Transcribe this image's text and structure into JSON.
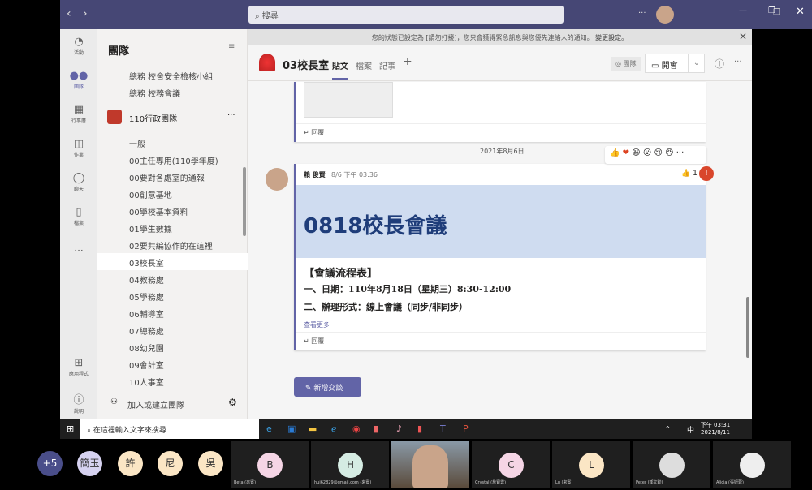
{
  "topbar": {
    "back": "‹",
    "forward": "›",
    "search_placeholder": "搜尋",
    "more": "···"
  },
  "rail": [
    {
      "label": "活動",
      "icon": "bell-icon",
      "glyph": "🔔"
    },
    {
      "label": "團隊",
      "icon": "teams-icon",
      "glyph": "👥"
    },
    {
      "label": "行事曆",
      "icon": "calendar-icon",
      "glyph": "📅"
    },
    {
      "label": "作業",
      "icon": "assignments-icon",
      "glyph": "🎒"
    },
    {
      "label": "聊天",
      "icon": "chat-icon",
      "glyph": "💬"
    },
    {
      "label": "檔案",
      "icon": "file-icon",
      "glyph": "📄"
    },
    {
      "label": "···",
      "icon": "more-icon",
      "glyph": ""
    },
    {
      "label": "應用程式",
      "icon": "apps-icon",
      "glyph": "⊞"
    },
    {
      "label": "說明",
      "icon": "help-icon",
      "glyph": "?"
    }
  ],
  "sidebar": {
    "title": "團隊",
    "channels_top": [
      "總務 校舍安全檢核小組",
      "總務 校務會議"
    ],
    "team_name": "110行政團隊",
    "channels": [
      "一般",
      "00主任專用(110學年度)",
      "00要對各處室的通報",
      "00創意基地",
      "00學校基本資料",
      "01學生數據",
      "02要共編協作的在這裡",
      "03校長室",
      "04教務處",
      "05學務處",
      "06輔導室",
      "07總務處",
      "08幼兒園",
      "09會計室",
      "10人事室"
    ],
    "selected": "03校長室",
    "add_team": "加入或建立團隊"
  },
  "banner": {
    "text": "您的狀態已設定為 [請勿打擾]，您只會獲得緊急訊息與您優先連絡人的通知。",
    "link": "變更設定。"
  },
  "channel_header": {
    "title": "03校長室",
    "tabs": [
      "貼文",
      "檔案",
      "記事"
    ],
    "team_button": "團隊",
    "meet_button": "開會"
  },
  "feed": {
    "reply": "回覆",
    "date_divider": "2021年8月6日",
    "post": {
      "author": "賴 俊賢",
      "time": "8/6 下午 03:36",
      "like_count": "1",
      "banner_title": "0818校長會議",
      "lines": [
        "【會議流程表】",
        "一、日期：110年8月18日（星期三）8:30-12:00",
        "二、辦理形式：線上會議（同步/非同步）"
      ],
      "see_more": "查看更多"
    },
    "reactions": [
      "👍",
      "❤",
      "😆",
      "😮",
      "😢",
      "😠"
    ],
    "new_conversation": "新增交談"
  },
  "taskbar": {
    "search": "在這裡輸入文字來搜尋",
    "time": "下午 03:31",
    "date": "2021/8/11",
    "ime": "中"
  },
  "participants": {
    "overflow": "+5",
    "avatars": [
      {
        "initials": "簡玉",
        "color": "#d6d2f0"
      },
      {
        "initials": "許",
        "color": "#fbe6c5"
      },
      {
        "initials": "尼",
        "color": "#fbe6c5"
      },
      {
        "initials": "吳",
        "color": "#fbe6c5"
      }
    ],
    "tiles": [
      {
        "initial": "B",
        "name": "Beta (來賓)",
        "color": "#f5d5e5"
      },
      {
        "initial": "H",
        "name": "hui62829@gmail.com (來賓)",
        "color": "#d5ece3"
      },
      {
        "initial": "C",
        "name": "Crystal (詹寶雲)",
        "color": "#f5d5e5"
      },
      {
        "initial": "L",
        "name": "Lu (來賓)",
        "color": "#fbe6c5"
      },
      {
        "initial": "",
        "name": "Peter (鄒文勳)",
        "color": "#ddd"
      },
      {
        "initial": "",
        "name": "Alicia (張妍蓉)",
        "color": "#eee"
      }
    ]
  }
}
